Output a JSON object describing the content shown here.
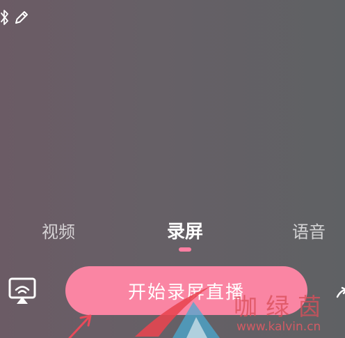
{
  "top_icons": [
    {
      "icon": "bluetooth-icon"
    },
    {
      "icon": "pencil-icon"
    }
  ],
  "tabs": [
    {
      "label": "视频",
      "active": false
    },
    {
      "label": "录屏",
      "active": true
    },
    {
      "label": "语音",
      "active": false
    }
  ],
  "cast_icon": "screen-cast-icon",
  "start_button": {
    "label": "开始录屏直播"
  },
  "watermark": {
    "brand_cn": "咖绿茵",
    "url": "www.kalvin.cn"
  },
  "colors": {
    "accent": "#fa85a3",
    "tab_indicator": "#ff7fa2",
    "background_left": "#6b5b65",
    "background_right": "#5f6164",
    "annotation": "#e84a5a"
  }
}
